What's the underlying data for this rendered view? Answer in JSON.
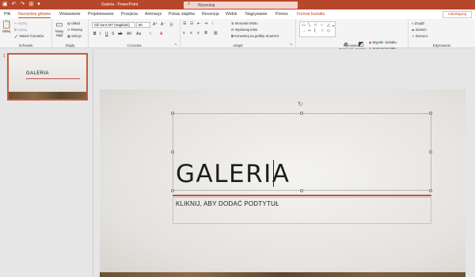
{
  "window": {
    "title": "Galeria - PowerPoint",
    "search_placeholder": "Wyszukaj",
    "share_label": "Udostępnij"
  },
  "tabs": [
    {
      "label": "Plik"
    },
    {
      "label": "Narzędzia główne"
    },
    {
      "label": "Wstawianie"
    },
    {
      "label": "Projektowanie"
    },
    {
      "label": "Przejścia"
    },
    {
      "label": "Animacje"
    },
    {
      "label": "Pokaz slajdów"
    },
    {
      "label": "Recenzja"
    },
    {
      "label": "Widok"
    },
    {
      "label": "Nagrywanie"
    },
    {
      "label": "Pomoc"
    },
    {
      "label": "Format kształtu"
    }
  ],
  "ribbon": {
    "clipboard": {
      "label": "Schowek",
      "paste": "Wklej",
      "cut": "Wytnij",
      "copy": "Kopiuj",
      "format_painter": "Malarz formatów"
    },
    "slides": {
      "label": "Slajdy",
      "new_slide": "Nowy slajd",
      "layout": "Układ",
      "reset": "Resetuj",
      "section": "Sekcja"
    },
    "font": {
      "label": "Czcionka",
      "font_name": "Gill Sans MT (Nagłówki)",
      "font_size": "66"
    },
    "paragraph": {
      "label": "Akapit",
      "text_direction": "Kierunek tekstu",
      "align_text": "Wyrównaj tekst",
      "smartart": "Konwertuj na grafikę SmartArt"
    },
    "drawing": {
      "label": "Rysowanie",
      "arrange": "Rozmieść",
      "quick_styles": "Szybkie style",
      "shape_fill": "Wypełn. kształtu",
      "shape_outline": "Kontury kształtu",
      "shape_effects": "Efekty kształtów"
    },
    "editing": {
      "label": "Edytowanie",
      "find": "Znajdź",
      "replace": "Zamień",
      "select": "Zaznacz"
    }
  },
  "thumbnails": [
    {
      "number": "1",
      "title": "GALERIA"
    }
  ],
  "slide": {
    "title": "GALERIA",
    "subtitle_placeholder": "KLIKNIJ, ABY DODAĆ PODTYTUŁ"
  },
  "colors": {
    "accent": "#b7472a",
    "title_line": "#c0504d"
  }
}
